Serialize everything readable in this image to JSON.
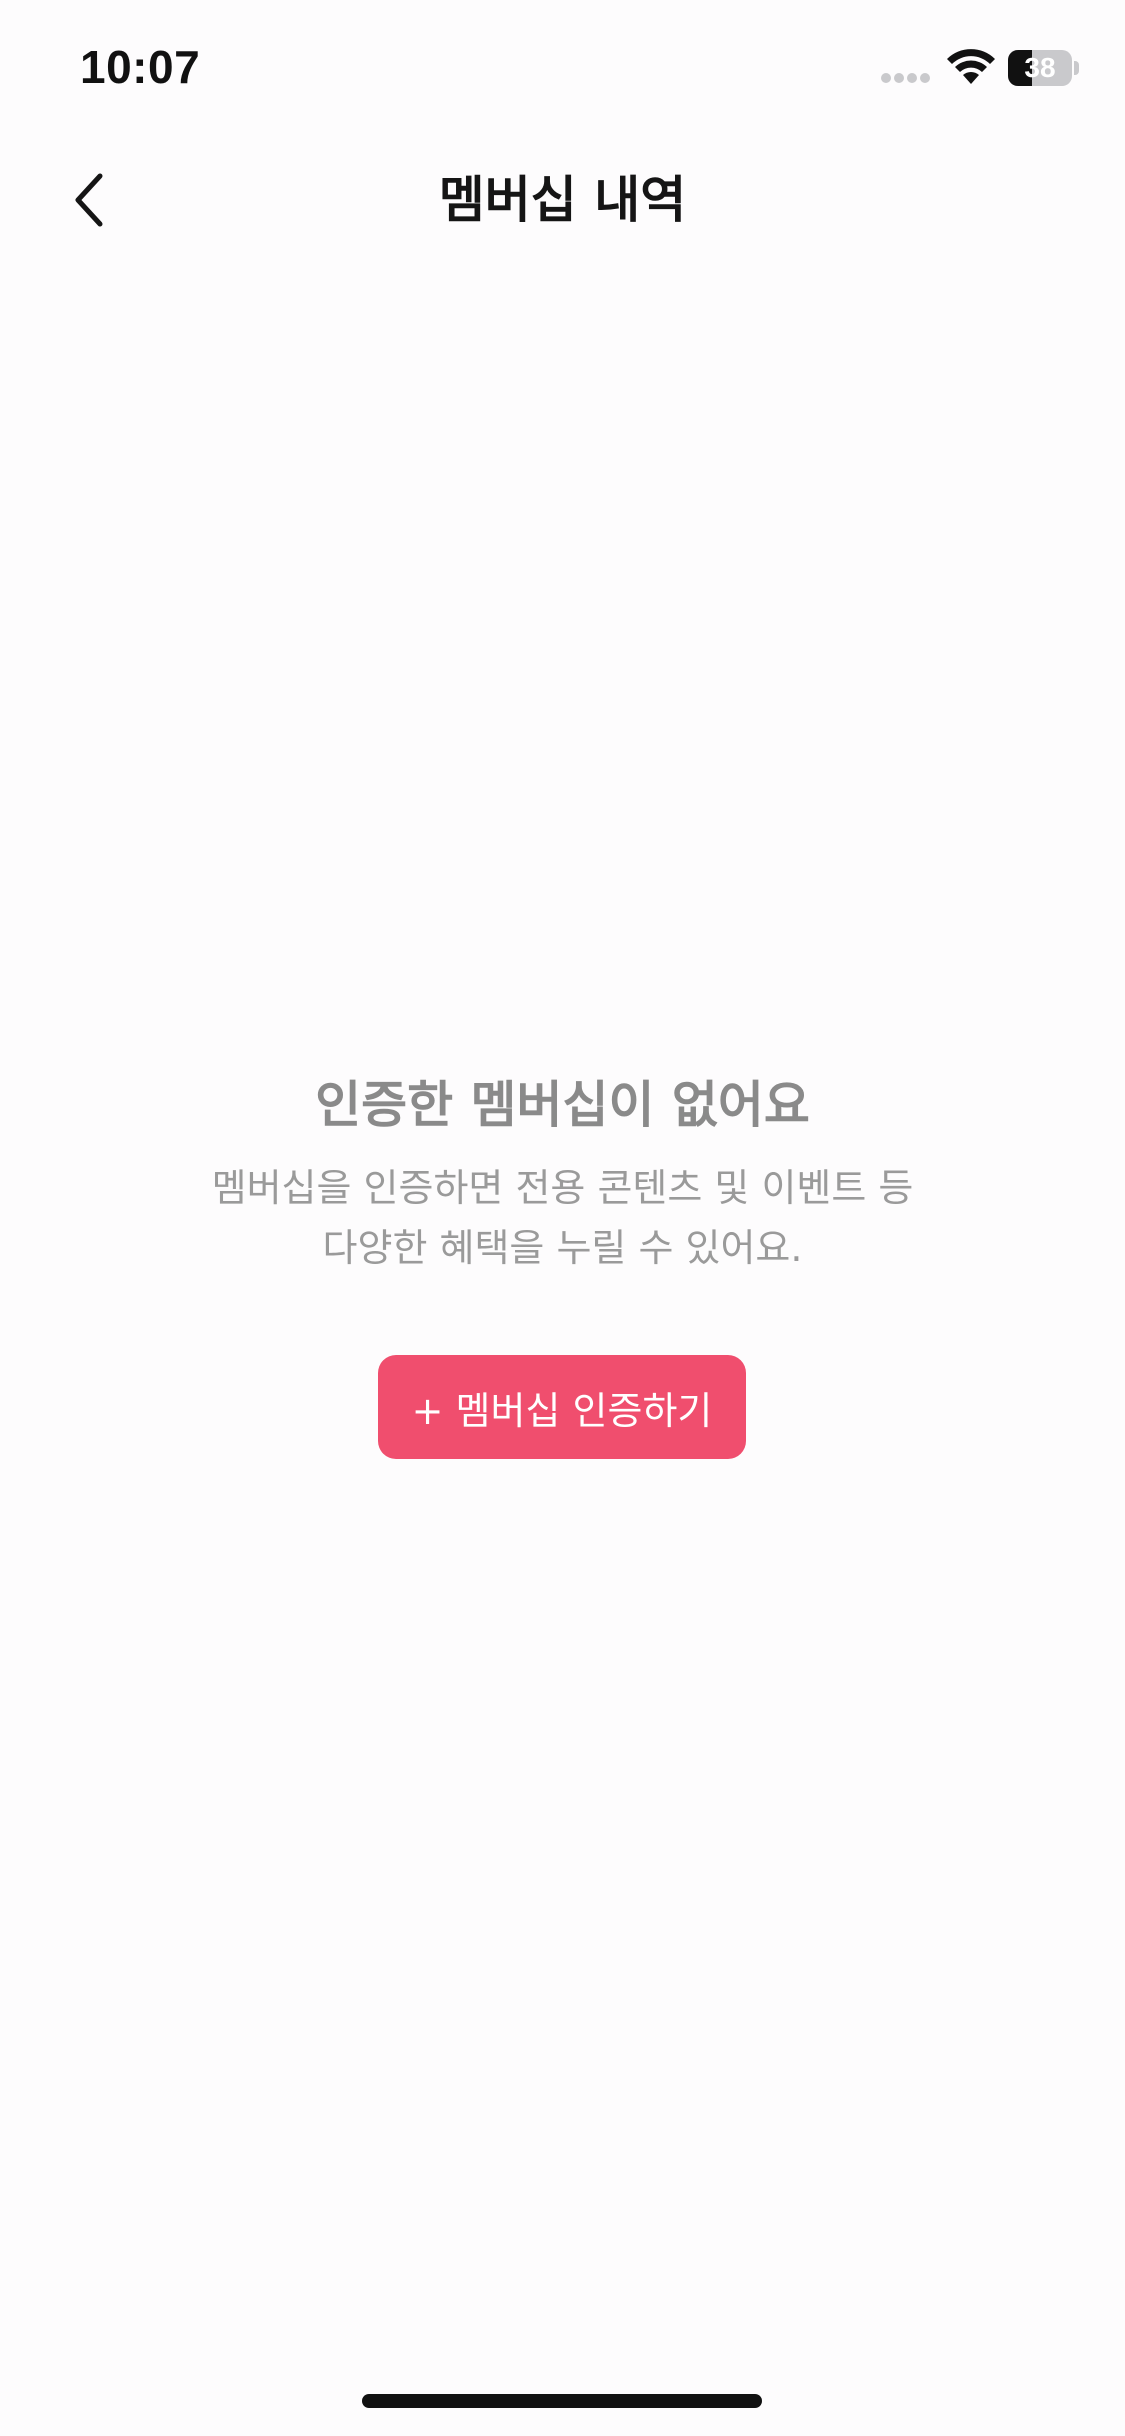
{
  "status_bar": {
    "time": "10:07",
    "battery_level": "38",
    "battery_fraction": 0.38,
    "icons": [
      "signal-icon",
      "wifi-icon",
      "battery-icon"
    ]
  },
  "header": {
    "title": "멤버십 내역",
    "back_icon": "chevron-left-icon"
  },
  "empty_state": {
    "title": "인증한 멤버십이 없어요",
    "description_line1": "멤버십을 인증하면 전용 콘텐츠 및 이벤트 등",
    "description_line2": "다양한 혜택을 누릴 수 있어요.",
    "cta_label": "+ 멤버십 인증하기"
  },
  "colors": {
    "accent": "#f04e6e",
    "background": "#fdfcfd",
    "muted_text": "#9a9a9a"
  }
}
